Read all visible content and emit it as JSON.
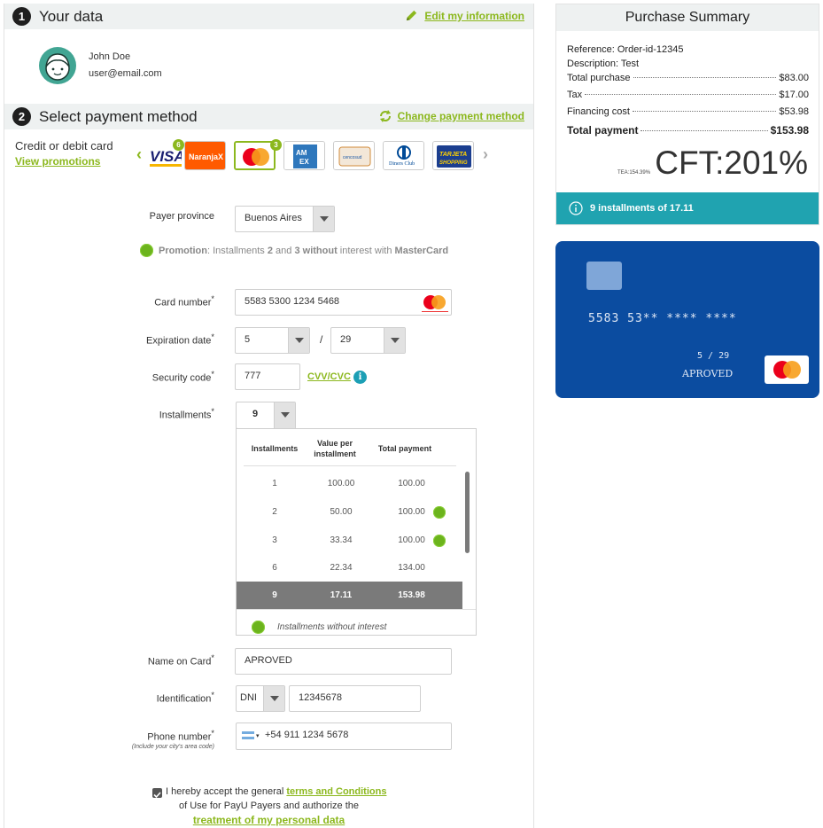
{
  "your_data": {
    "step": "1",
    "title": "Your data",
    "edit_link": "Edit my information",
    "user_name": "John Doe",
    "user_email": "user@email.com"
  },
  "payment": {
    "step": "2",
    "title": "Select payment method",
    "change_link": "Change payment method",
    "method_label": "Credit or debit card",
    "promotions_link": "View promotions",
    "carousel_prev": "‹",
    "carousel_next": "›",
    "cards": [
      {
        "name": "VISA",
        "badge": "6"
      },
      {
        "name": "NaranjaX",
        "badge": ""
      },
      {
        "name": "Mastercard",
        "badge": "3",
        "selected": true
      },
      {
        "name": "AMEX",
        "badge": ""
      },
      {
        "name": "cencosud",
        "badge": ""
      },
      {
        "name": "Diners Club INTERNATIONAL",
        "badge": ""
      },
      {
        "name": "TARJETA SHOPPING",
        "badge": ""
      }
    ]
  },
  "form": {
    "province_label": "Payer province",
    "province_value": "Buenos Aires",
    "promo_prefix": "Promotion",
    "promo_mid1": ": Installments ",
    "promo_n1": "2",
    "promo_and": " and ",
    "promo_n2": "3",
    "promo_without": " without",
    "promo_rest": " interest with ",
    "promo_brand": "MasterCard",
    "card_number_label": "Card number",
    "card_number_value": "5583 5300 1234 5468",
    "expiration_label": "Expiration date",
    "exp_month": "5",
    "exp_sep": "/",
    "exp_year": "29",
    "security_label": "Security code",
    "security_value": "777",
    "cvv_link": "CVV/CVC",
    "installments_label": "Installments",
    "installments_value": "9",
    "name_label": "Name on Card",
    "name_value": "APROVED",
    "id_label": "Identification",
    "id_type": "DNI",
    "id_value": "12345678",
    "phone_label": "Phone number",
    "phone_hint": "(Include your city's area code)",
    "phone_value": "+54 911 1234 5678",
    "required_mark": "*",
    "terms_prefix": "I hereby accept the general ",
    "terms_link": "terms and Conditions",
    "terms_mid": "of Use for PayU Payers and authorize the",
    "privacy_link": "treatment of my personal data",
    "terms_checked": true
  },
  "installments_table": {
    "headers": [
      "Installments",
      "Value per installment",
      "Total payment"
    ],
    "rows": [
      {
        "n": "1",
        "value": "100.00",
        "total": "100.00",
        "no_interest": false
      },
      {
        "n": "2",
        "value": "50.00",
        "total": "100.00",
        "no_interest": true
      },
      {
        "n": "3",
        "value": "33.34",
        "total": "100.00",
        "no_interest": true
      },
      {
        "n": "6",
        "value": "22.34",
        "total": "134.00",
        "no_interest": false
      },
      {
        "n": "9",
        "value": "17.11",
        "total": "153.98",
        "no_interest": false,
        "selected": true
      }
    ],
    "legend": "Installments without interest"
  },
  "summary": {
    "title": "Purchase Summary",
    "reference": "Reference: Order-id-12345",
    "description": "Description: Test",
    "lines": [
      {
        "label": "Total purchase",
        "amount": "$83.00"
      },
      {
        "label": "Tax",
        "amount": "$17.00"
      },
      {
        "label": "Financing cost",
        "amount": "$53.98"
      }
    ],
    "total_label": "Total payment",
    "total_amount": "$153.98",
    "tea": "TEA:154.39%",
    "cft": "CFT:201%",
    "installments_banner": "9 installments of 17.11"
  },
  "card_preview": {
    "number": "5583 53** **** ****",
    "expiry": "5 / 29",
    "name": "APROVED"
  },
  "colors": {
    "accent_green": "#8cb81e",
    "teal": "#20a3b0",
    "card_blue": "#0b4ca0"
  }
}
